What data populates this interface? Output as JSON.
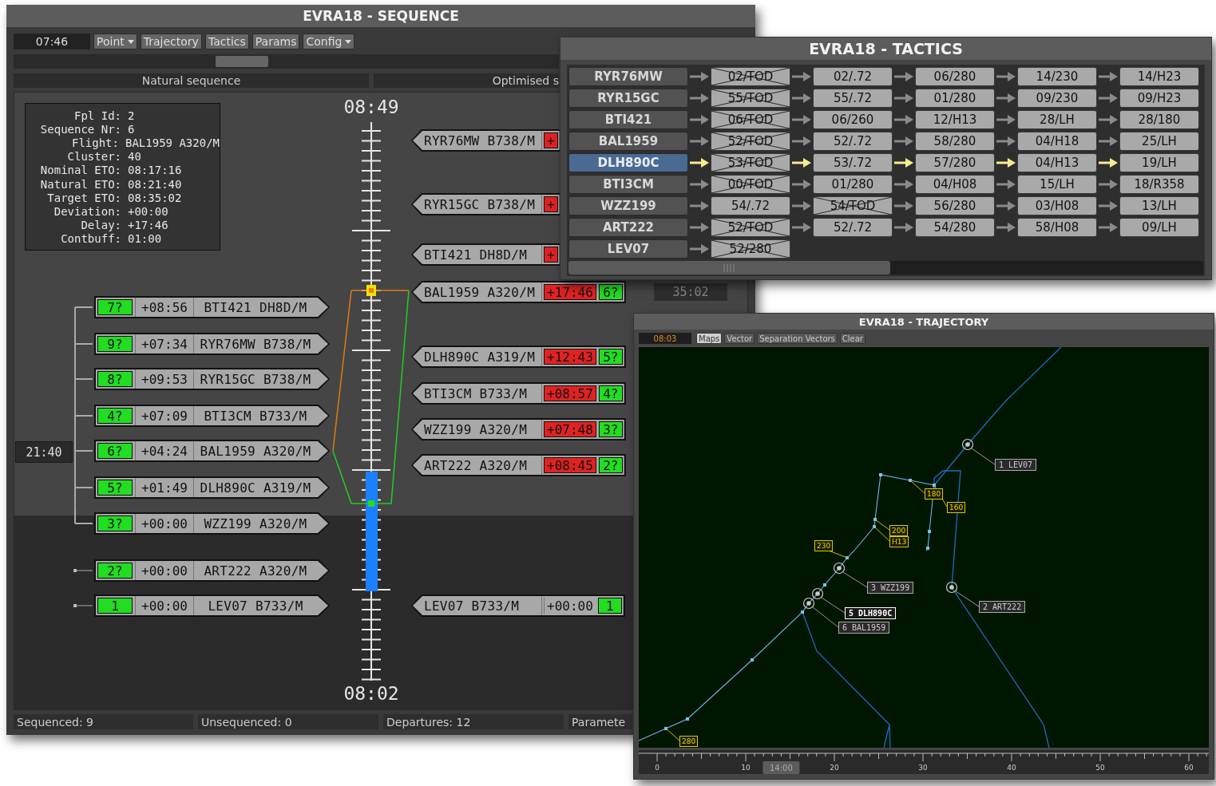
{
  "sequence_window": {
    "title": "EVRA18 - SEQUENCE",
    "clock": "07:46",
    "toolbar": [
      {
        "label": "Point",
        "kind": "dropdown"
      },
      {
        "label": "Trajectory",
        "kind": "button"
      },
      {
        "label": "Tactics",
        "kind": "button"
      },
      {
        "label": "Params",
        "kind": "button"
      },
      {
        "label": "Config",
        "kind": "dropdown"
      }
    ],
    "headers": [
      "Natural sequence",
      "Optimised s"
    ],
    "info": [
      {
        "label": "Fpl Id:",
        "value": "2"
      },
      {
        "label": "Sequence Nr:",
        "value": "6"
      },
      {
        "label": "Flight:",
        "value": "BAL1959 A320/M"
      },
      {
        "label": "Cluster:",
        "value": "40"
      },
      {
        "label": "Nominal ETO:",
        "value": "08:17:16"
      },
      {
        "label": "Natural ETO:",
        "value": "08:21:40"
      },
      {
        "label": "Target ETO:",
        "value": "08:35:02"
      },
      {
        "label": "Deviation:",
        "value": "+00:00"
      },
      {
        "label": "Delay:",
        "value": "+17:46"
      },
      {
        "label": "Contbuff:",
        "value": "01:00"
      }
    ],
    "scale_top": "08:49",
    "scale_bottom": "08:02",
    "total_delay": "21:40",
    "natural": [
      {
        "seq": "7?",
        "offset": "+08:56",
        "flight": "BTI421 DH8D/M",
        "grouped": true
      },
      {
        "seq": "9?",
        "offset": "+07:34",
        "flight": "RYR76MW B738/M",
        "grouped": true
      },
      {
        "seq": "8?",
        "offset": "+09:53",
        "flight": "RYR15GC B738/M",
        "grouped": true
      },
      {
        "seq": "4?",
        "offset": "+07:09",
        "flight": "BTI3CM B733/M",
        "grouped": true
      },
      {
        "seq": "6?",
        "offset": "+04:24",
        "flight": "BAL1959 A320/M",
        "grouped": true
      },
      {
        "seq": "5?",
        "offset": "+01:49",
        "flight": "DLH890C A319/M",
        "grouped": true
      },
      {
        "seq": "3?",
        "offset": "+00:00",
        "flight": "WZZ199 A320/M",
        "grouped": true
      },
      {
        "seq": "2?",
        "offset": "+00:00",
        "flight": "ART222 A320/M",
        "grouped": false
      },
      {
        "seq": "1",
        "offset": "+00:00",
        "flight": "LEV07 B733/M",
        "grouped": false
      }
    ],
    "optimised": [
      {
        "flight": "RYR76MW B738/M",
        "delay": "+",
        "kind": "late"
      },
      {
        "flight": "RYR15GC B738/M",
        "delay": "+",
        "kind": "late"
      },
      {
        "flight": "BTI421 DH8D/M",
        "delay": "+",
        "kind": "late"
      },
      {
        "flight": "BAL1959 A320/M",
        "delay": "+17:46",
        "kind": "late",
        "seq": "6?"
      },
      {
        "flight": "DLH890C A319/M",
        "delay": "+12:43",
        "kind": "late",
        "seq": "5?"
      },
      {
        "flight": "BTI3CM B733/M",
        "delay": "+08:57",
        "kind": "late",
        "seq": "4?"
      },
      {
        "flight": "WZZ199 A320/M",
        "delay": "+07:48",
        "kind": "late",
        "seq": "3?"
      },
      {
        "flight": "ART222 A320/M",
        "delay": "+08:45",
        "kind": "late",
        "seq": "2?"
      },
      {
        "flight": "LEV07 B733/M",
        "delay": "+00:00",
        "kind": "on_time",
        "seq": "1"
      }
    ],
    "target_time": "35:02",
    "status": [
      "Sequenced: 9",
      "Unsequenced: 0",
      "Departures: 12",
      "Paramete"
    ]
  },
  "tactics_window": {
    "title": "EVRA18 - TACTICS",
    "rows": [
      {
        "flight": "RYR76MW",
        "selected": false,
        "steps": [
          {
            "text": "02/TOD",
            "crossed": true
          },
          {
            "text": "02/.72",
            "crossed": false
          },
          {
            "text": "06/280",
            "crossed": false
          },
          {
            "text": "14/230",
            "crossed": false
          },
          {
            "text": "14/H23",
            "crossed": false
          }
        ]
      },
      {
        "flight": "RYR15GC",
        "selected": false,
        "steps": [
          {
            "text": "55/TOD",
            "crossed": true
          },
          {
            "text": "55/.72",
            "crossed": false
          },
          {
            "text": "01/280",
            "crossed": false
          },
          {
            "text": "09/230",
            "crossed": false
          },
          {
            "text": "09/H23",
            "crossed": false
          }
        ]
      },
      {
        "flight": "BTI421",
        "selected": false,
        "steps": [
          {
            "text": "06/TOD",
            "crossed": true
          },
          {
            "text": "06/260",
            "crossed": false
          },
          {
            "text": "12/H13",
            "crossed": false
          },
          {
            "text": "28/LH",
            "crossed": false
          },
          {
            "text": "28/180",
            "crossed": false
          }
        ]
      },
      {
        "flight": "BAL1959",
        "selected": false,
        "steps": [
          {
            "text": "52/TOD",
            "crossed": true
          },
          {
            "text": "52/.72",
            "crossed": false
          },
          {
            "text": "58/280",
            "crossed": false
          },
          {
            "text": "04/H18",
            "crossed": false
          },
          {
            "text": "25/LH",
            "crossed": false
          }
        ]
      },
      {
        "flight": "DLH890C",
        "selected": true,
        "steps": [
          {
            "text": "53/TOD",
            "crossed": true
          },
          {
            "text": "53/.72",
            "crossed": false
          },
          {
            "text": "57/280",
            "crossed": false
          },
          {
            "text": "04/H13",
            "crossed": false
          },
          {
            "text": "19/LH",
            "crossed": false
          }
        ]
      },
      {
        "flight": "BTI3CM",
        "selected": false,
        "steps": [
          {
            "text": "00/TOD",
            "crossed": true
          },
          {
            "text": "01/280",
            "crossed": false
          },
          {
            "text": "04/H08",
            "crossed": false
          },
          {
            "text": "15/LH",
            "crossed": false
          },
          {
            "text": "18/R358",
            "crossed": false
          }
        ]
      },
      {
        "flight": "WZZ199",
        "selected": false,
        "steps": [
          {
            "text": "54/.72",
            "crossed": false
          },
          {
            "text": "54/TOD",
            "crossed": true
          },
          {
            "text": "56/280",
            "crossed": false
          },
          {
            "text": "03/H08",
            "crossed": false
          },
          {
            "text": "13/LH",
            "crossed": false
          }
        ]
      },
      {
        "flight": "ART222",
        "selected": false,
        "steps": [
          {
            "text": "52/TOD",
            "crossed": true
          },
          {
            "text": "52/.72",
            "crossed": false
          },
          {
            "text": "54/280",
            "crossed": false
          },
          {
            "text": "58/H08",
            "crossed": false
          },
          {
            "text": "09/LH",
            "crossed": false
          }
        ]
      },
      {
        "flight": "LEV07",
        "selected": false,
        "steps": [
          {
            "text": "52/280",
            "crossed": true
          }
        ]
      }
    ]
  },
  "trajectory_window": {
    "title": "EVRA18 - TRAJECTORY",
    "clock": "08:03",
    "toolbar": [
      {
        "label": "Maps",
        "selected": true
      },
      {
        "label": "Vector",
        "selected": false
      },
      {
        "label": "Separation Vectors",
        "selected": false
      },
      {
        "label": "Clear",
        "selected": false
      }
    ],
    "aircraft": [
      {
        "label": "1 LEV07",
        "selected": false
      },
      {
        "label": "3 WZZ199",
        "selected": false
      },
      {
        "label": "5 DLH890C",
        "selected": true
      },
      {
        "label": "6 BAL1959",
        "selected": false
      },
      {
        "label": "2 ART222",
        "selected": false
      }
    ],
    "level_tags": [
      "180",
      "160",
      "200",
      "H13",
      "230",
      "280"
    ],
    "scale_ticks": [
      "0",
      "10",
      "20",
      "30",
      "40",
      "50",
      "60"
    ],
    "scale_cursor": "14:00"
  }
}
